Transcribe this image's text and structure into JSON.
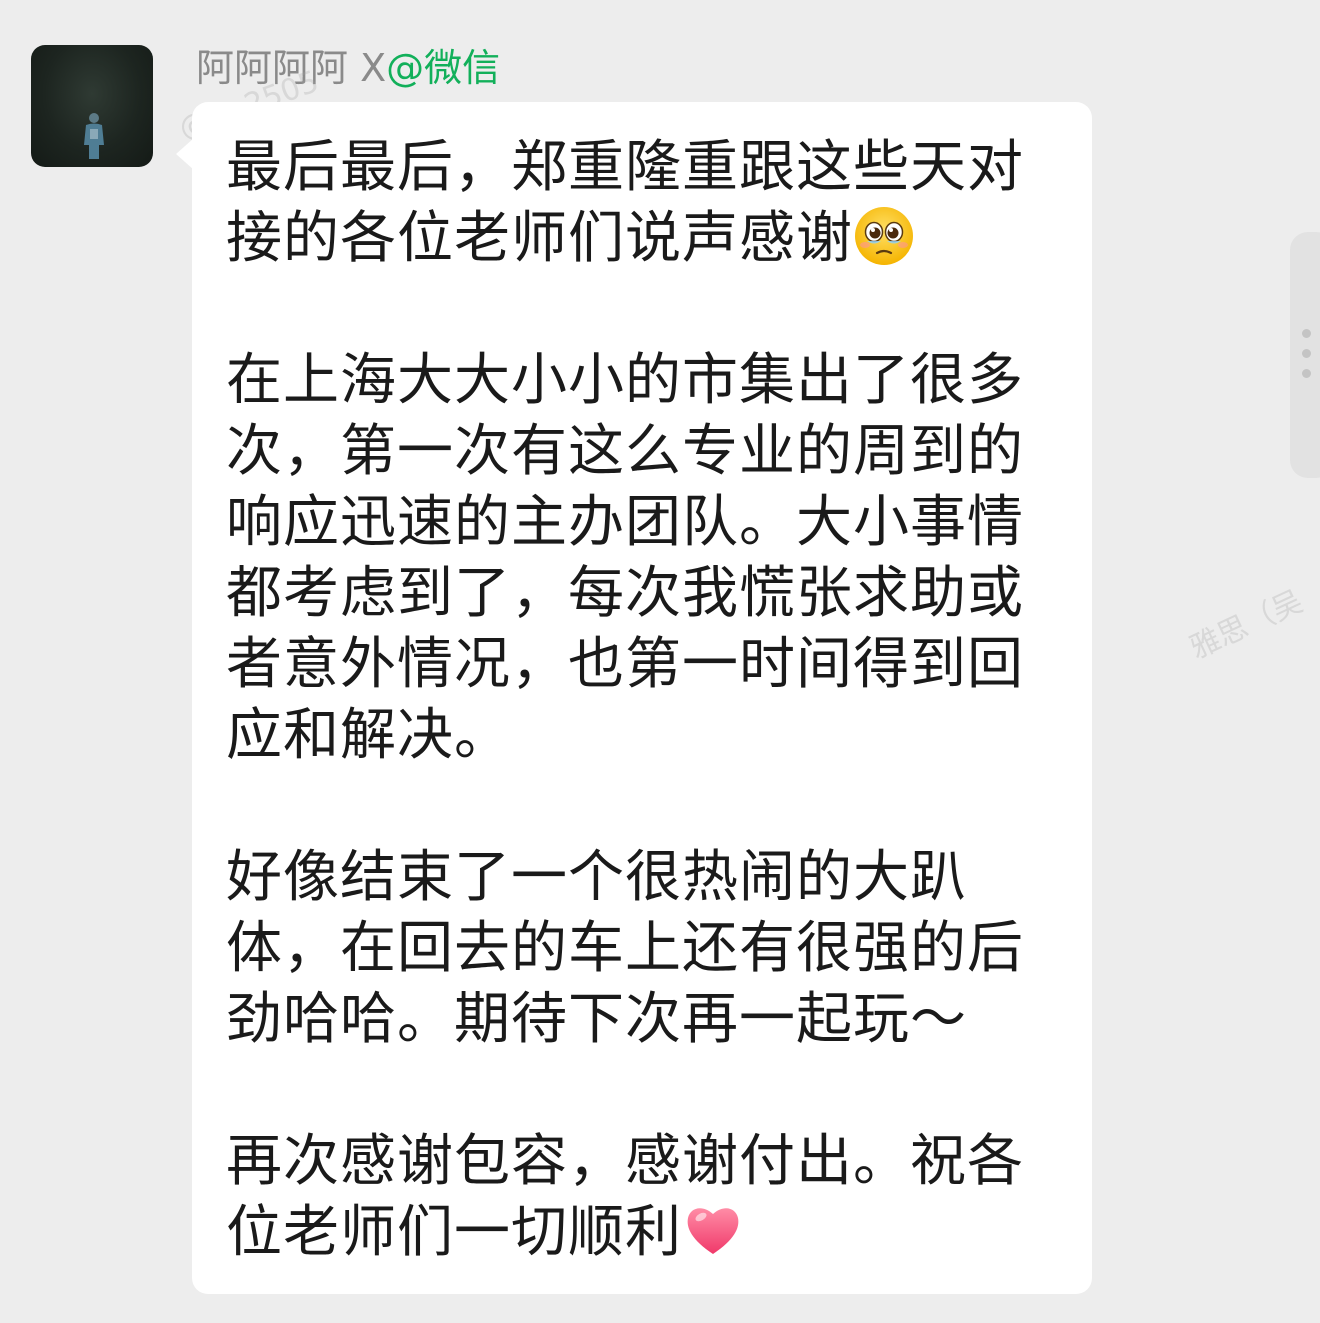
{
  "chat": {
    "sender_name": "阿阿阿阿 X",
    "sender_source": "@微信",
    "message_paragraphs": [
      "最后最后，郑重隆重跟这些天对接的各位老师们说声感谢",
      "在上海大大小小的市集出了很多次，第一次有这么专业的周到的响应迅速的主办团队。大小事情都考虑到了，每次我慌张求助或者意外情况，也第一时间得到回应和解决。",
      "好像结束了一个很热闹的大趴体，在回去的车上还有很强的后劲哈哈。期待下次再一起玩～",
      "再次感谢包容，感谢付出。祝各位老师们一切顺利"
    ],
    "emojis": {
      "after_paragraph_1": "pleading-teary-face-icon",
      "after_paragraph_4": "red-heart-icon"
    }
  },
  "colors": {
    "background": "#ededed",
    "bubble": "#ffffff",
    "sender_name": "#8a8a8a",
    "source_green": "#12b05a",
    "text": "#1a1a1a"
  },
  "watermarks": [
    "@… 2505",
    "雅思（吴"
  ]
}
